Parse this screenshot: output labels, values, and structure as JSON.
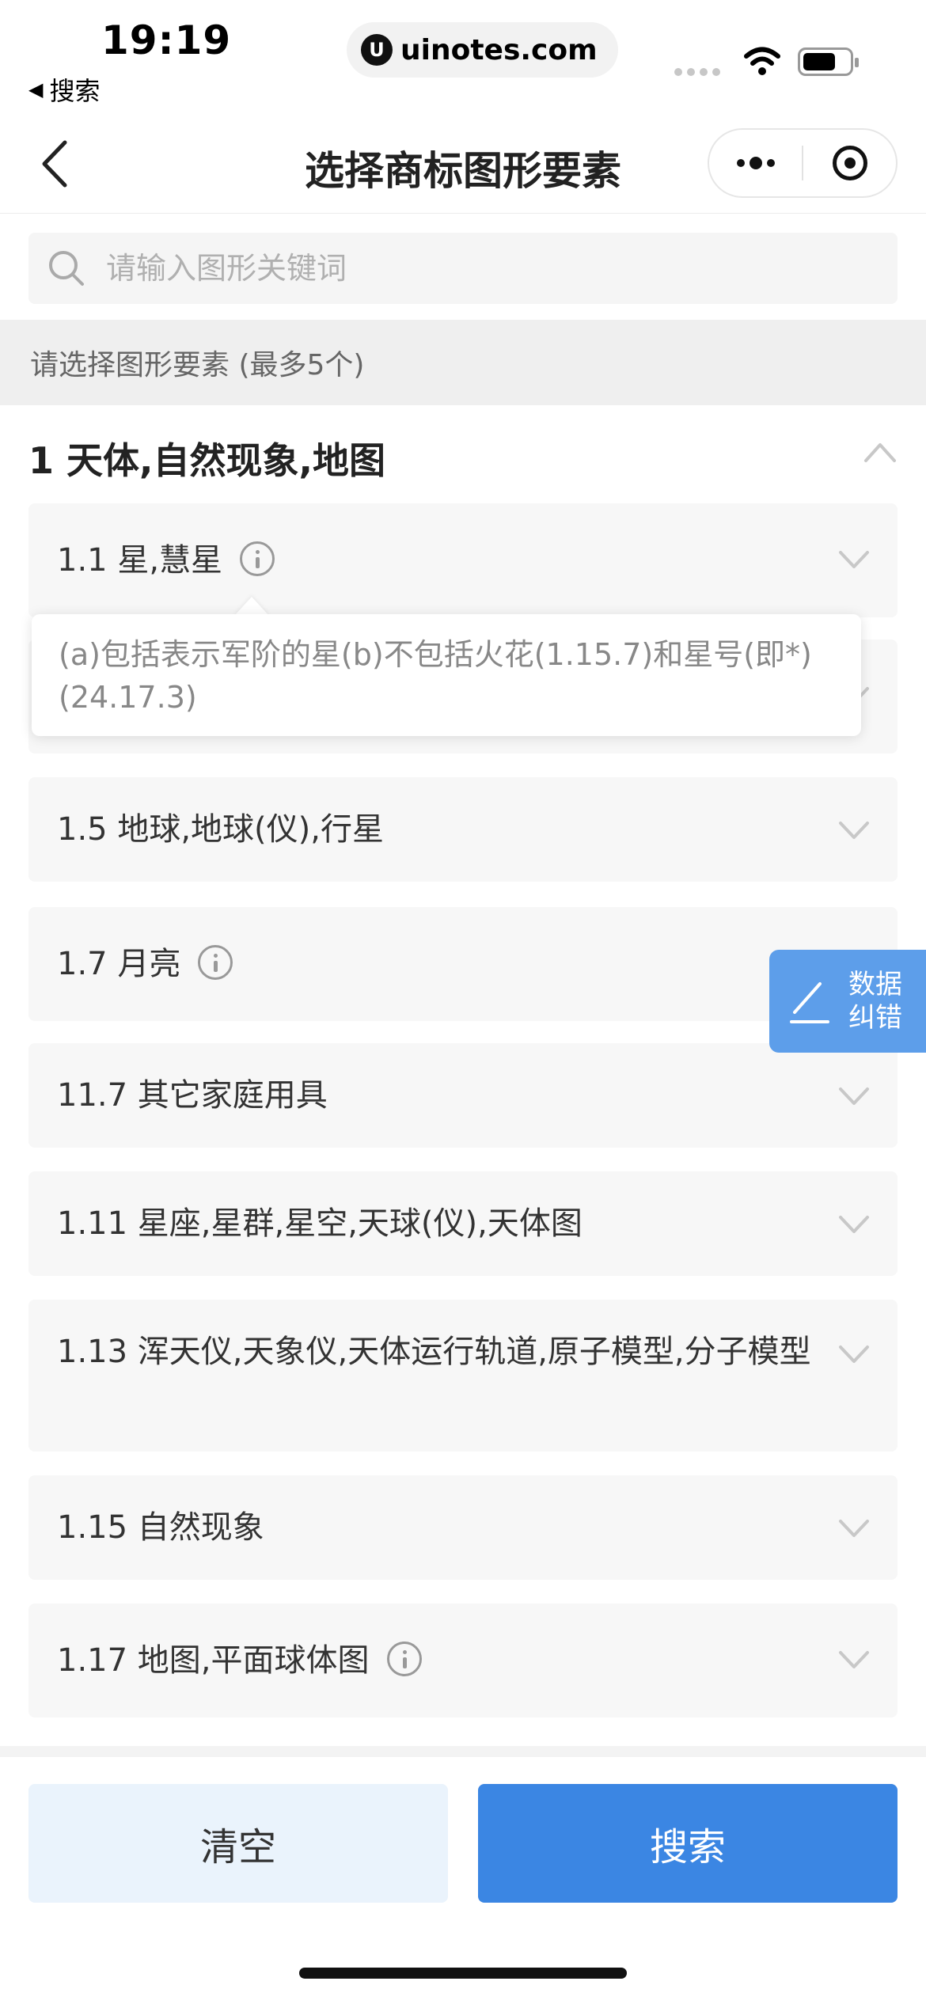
{
  "status_bar": {
    "time": "19:19",
    "back_app_label": "搜索",
    "url": "uinotes.com"
  },
  "nav": {
    "title": "选择商标图形要素"
  },
  "search": {
    "placeholder": "请输入图形关键词",
    "value": ""
  },
  "hint": "请选择图形要素 (最多5个)",
  "category": {
    "title": "1 天体,自然现象,地图",
    "expanded": true
  },
  "items": [
    {
      "label": "1.1  星,慧星",
      "has_info": true
    },
    {
      "label": "",
      "has_info": false
    },
    {
      "label": "1.5  地球,地球(仪),行星",
      "has_info": false
    },
    {
      "label": "1.7  月亮",
      "has_info": true
    },
    {
      "label": "11.7  其它家庭用具",
      "has_info": false
    },
    {
      "label": "1.11  星座,星群,星空,天球(仪),天体图",
      "has_info": false
    },
    {
      "label": "1.13  浑天仪,天象仪,天体运行轨道,原子模型,分子模型",
      "has_info": false
    },
    {
      "label": "1.15  自然现象",
      "has_info": false
    },
    {
      "label": "1.17  地图,平面球体图",
      "has_info": true
    }
  ],
  "tooltip": {
    "text": "(a)包括表示军阶的星(b)不包括火花(1.15.7)和星号(即*)(24.17.3)"
  },
  "fab": {
    "line1": "数据",
    "line2": "纠错"
  },
  "buttons": {
    "clear": "清空",
    "search": "搜索"
  },
  "colors": {
    "primary": "#3b86e3",
    "clear_bg": "#eaf3fc",
    "fab_bg": "#5d9eea",
    "item_bg": "#f7f7f7"
  }
}
